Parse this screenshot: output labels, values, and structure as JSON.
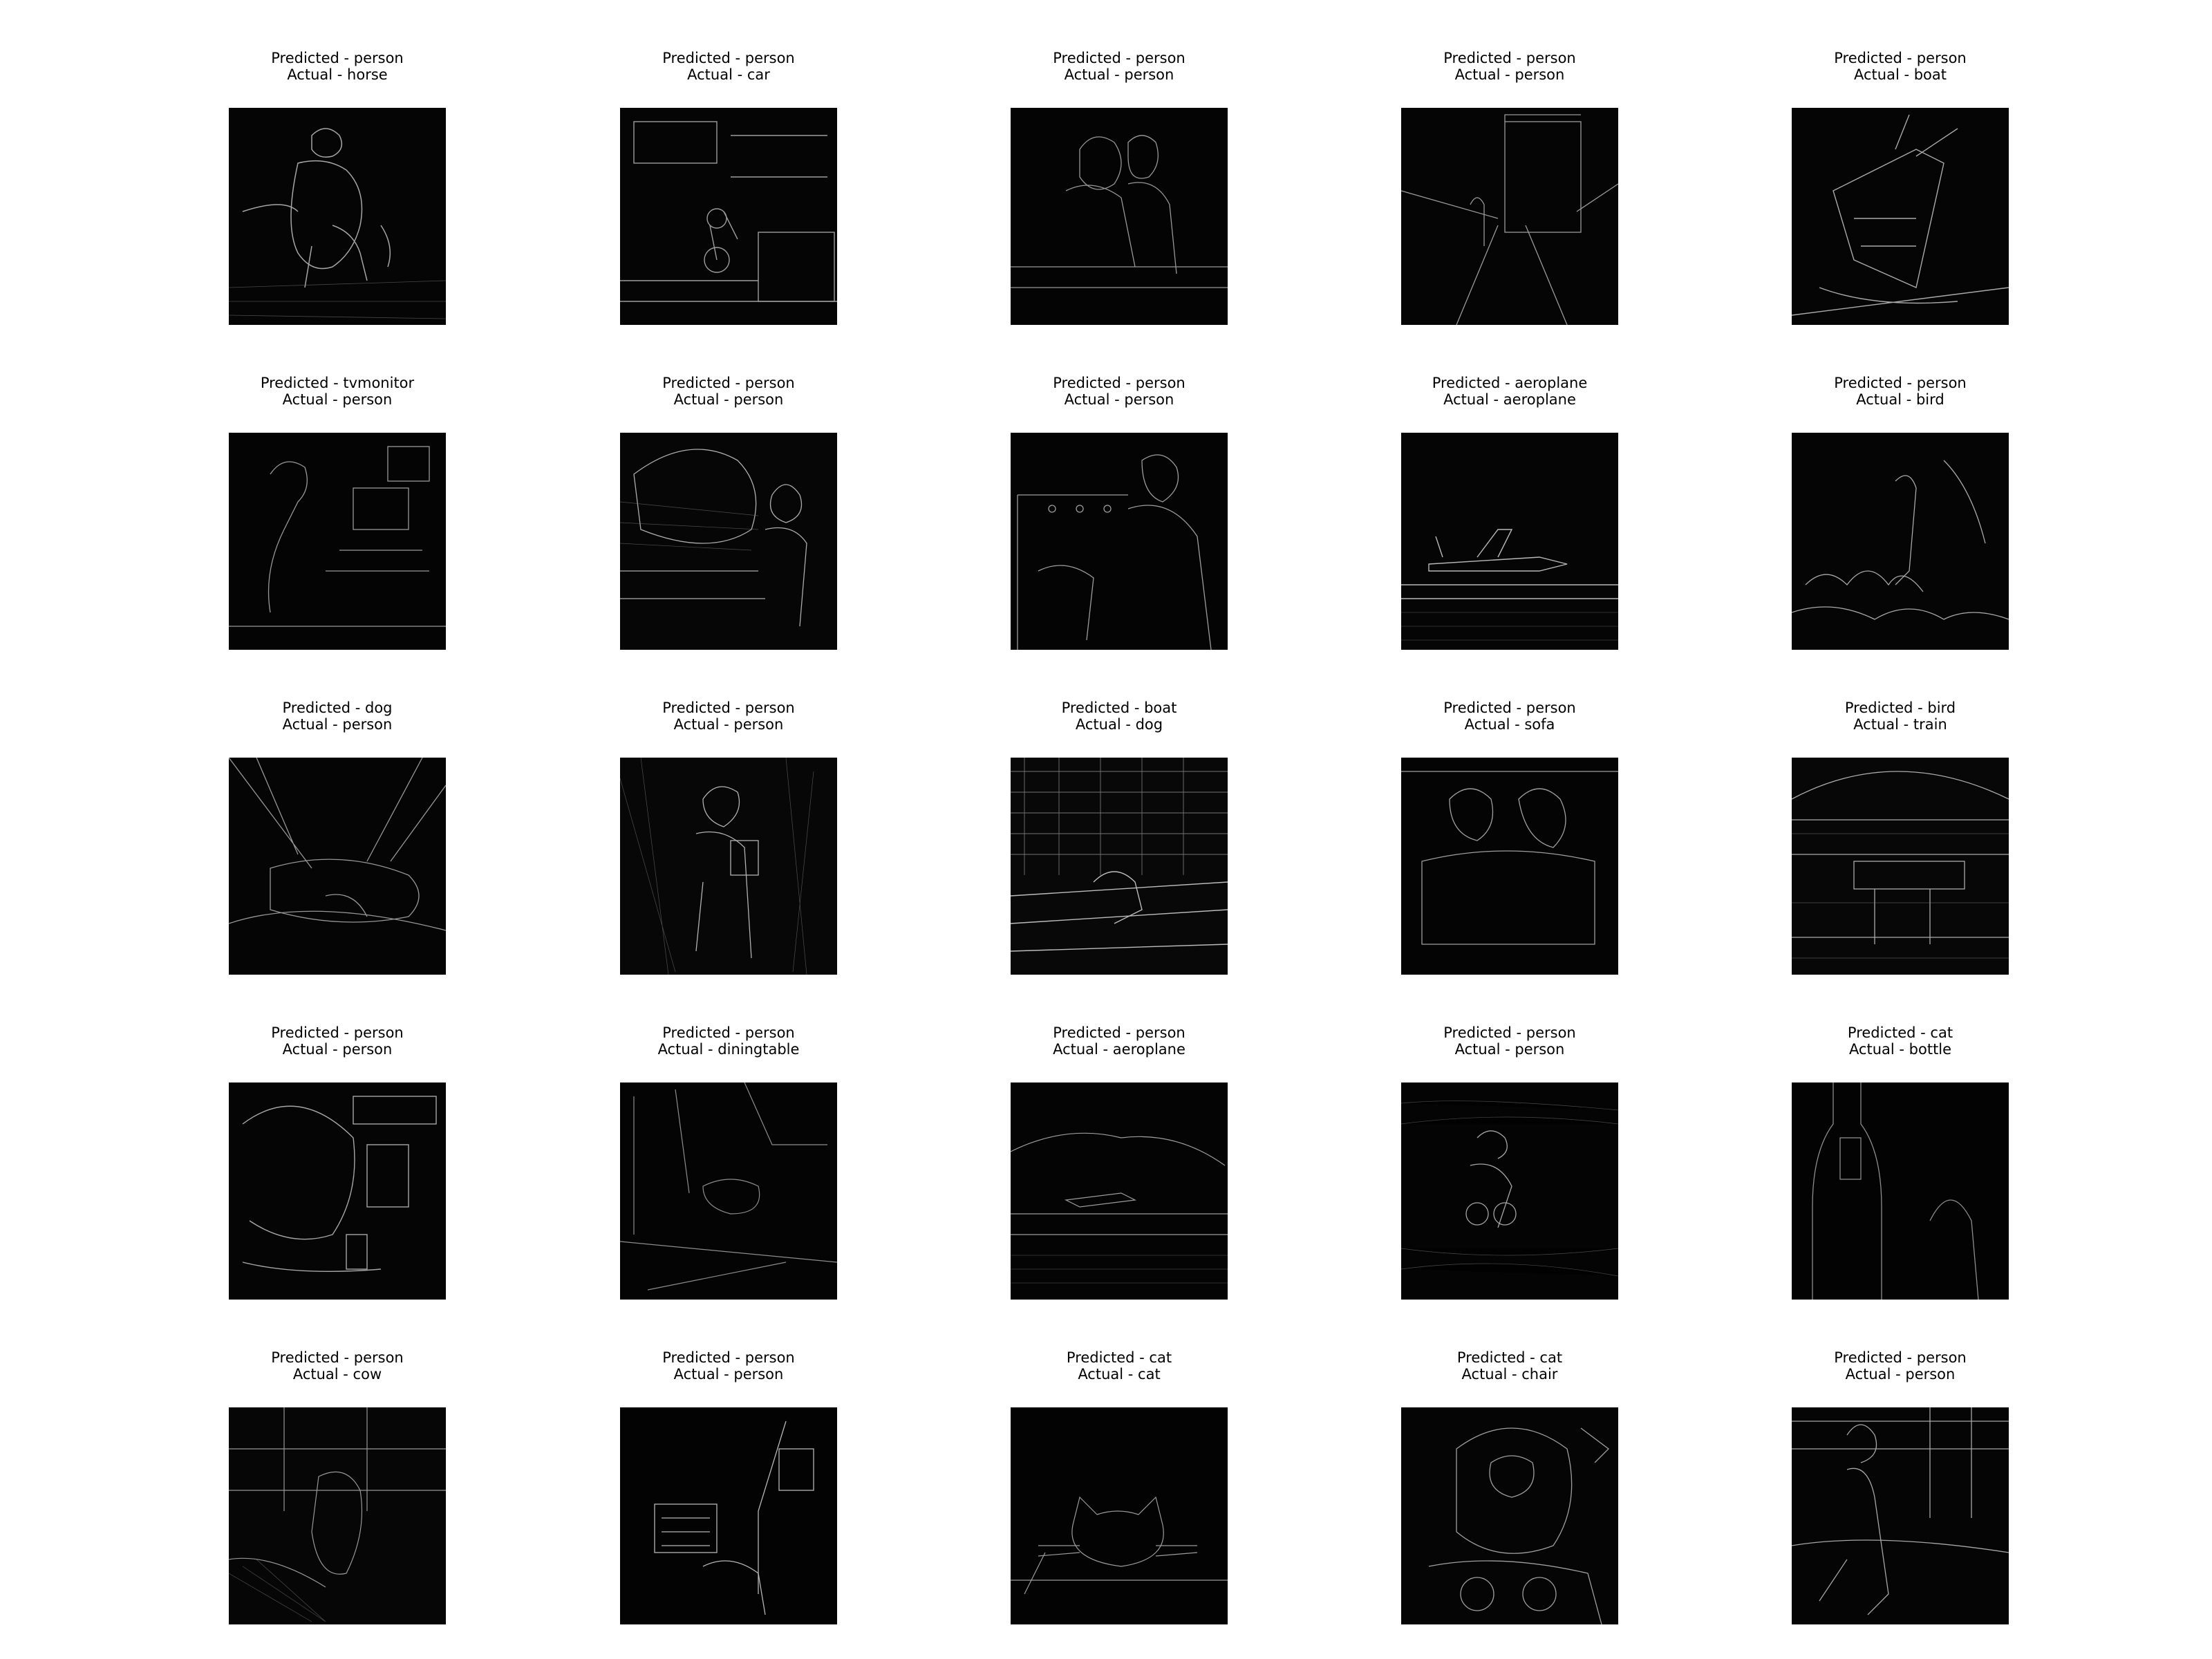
{
  "panels": [
    {
      "predicted": "Predicted - person",
      "actual": "Actual - horse"
    },
    {
      "predicted": "Predicted - person",
      "actual": "Actual - car"
    },
    {
      "predicted": "Predicted - person",
      "actual": "Actual - person"
    },
    {
      "predicted": "Predicted - person",
      "actual": "Actual - person"
    },
    {
      "predicted": "Predicted - person",
      "actual": "Actual - boat"
    },
    {
      "predicted": "Predicted - tvmonitor",
      "actual": "Actual - person"
    },
    {
      "predicted": "Predicted - person",
      "actual": "Actual - person"
    },
    {
      "predicted": "Predicted - person",
      "actual": "Actual - person"
    },
    {
      "predicted": "Predicted - aeroplane",
      "actual": "Actual - aeroplane"
    },
    {
      "predicted": "Predicted - person",
      "actual": "Actual - bird"
    },
    {
      "predicted": "Predicted - dog",
      "actual": "Actual - person"
    },
    {
      "predicted": "Predicted - person",
      "actual": "Actual - person"
    },
    {
      "predicted": "Predicted - boat",
      "actual": "Actual - dog"
    },
    {
      "predicted": "Predicted - person",
      "actual": "Actual - sofa"
    },
    {
      "predicted": "Predicted - bird",
      "actual": "Actual - train"
    },
    {
      "predicted": "Predicted - person",
      "actual": "Actual - person"
    },
    {
      "predicted": "Predicted - person",
      "actual": "Actual - diningtable"
    },
    {
      "predicted": "Predicted - person",
      "actual": "Actual - aeroplane"
    },
    {
      "predicted": "Predicted - person",
      "actual": "Actual - person"
    },
    {
      "predicted": "Predicted - cat",
      "actual": "Actual - bottle"
    },
    {
      "predicted": "Predicted - person",
      "actual": "Actual - cow"
    },
    {
      "predicted": "Predicted - person",
      "actual": "Actual - person"
    },
    {
      "predicted": "Predicted - cat",
      "actual": "Actual - cat"
    },
    {
      "predicted": "Predicted - cat",
      "actual": "Actual - chair"
    },
    {
      "predicted": "Predicted - person",
      "actual": "Actual - person"
    }
  ]
}
